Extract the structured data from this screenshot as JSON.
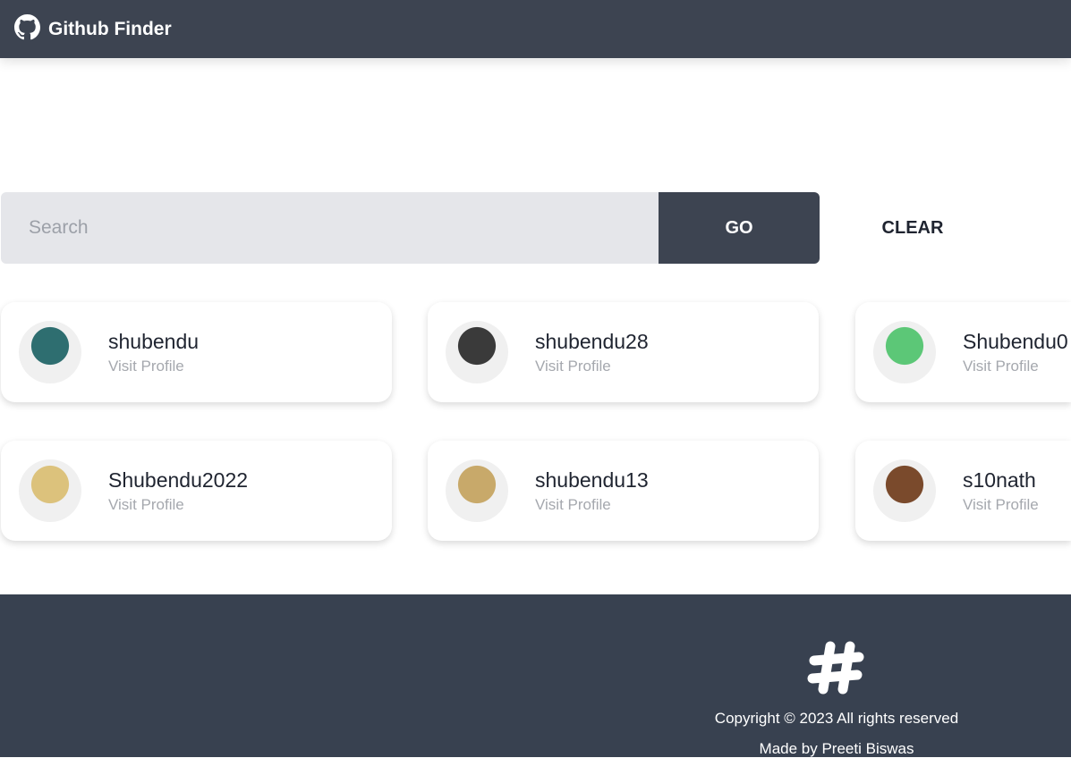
{
  "header": {
    "title": "Github Finder",
    "icon": "github-icon"
  },
  "search": {
    "placeholder": "Search",
    "value": "",
    "go_label": "GO",
    "clear_label": "CLEAR"
  },
  "users": [
    {
      "name": "shubendu",
      "link": "Visit Profile",
      "avatar_color": "#2e6e70"
    },
    {
      "name": "shubendu28",
      "link": "Visit Profile",
      "avatar_color": "#3a3a3a"
    },
    {
      "name": "Shubendu0",
      "link": "Visit Profile",
      "avatar_color": "#5cc777"
    },
    {
      "name": "Shubendu2022",
      "link": "Visit Profile",
      "avatar_color": "#dcc27c"
    },
    {
      "name": "shubendu13",
      "link": "Visit Profile",
      "avatar_color": "#c8a96a"
    },
    {
      "name": "s10nath",
      "link": "Visit Profile",
      "avatar_color": "#7a4a2c"
    }
  ],
  "footer": {
    "icon": "hashtag-icon",
    "copyright": "Copyright © 2023 All rights reserved",
    "credit": "Made by Preeti Biswas"
  }
}
